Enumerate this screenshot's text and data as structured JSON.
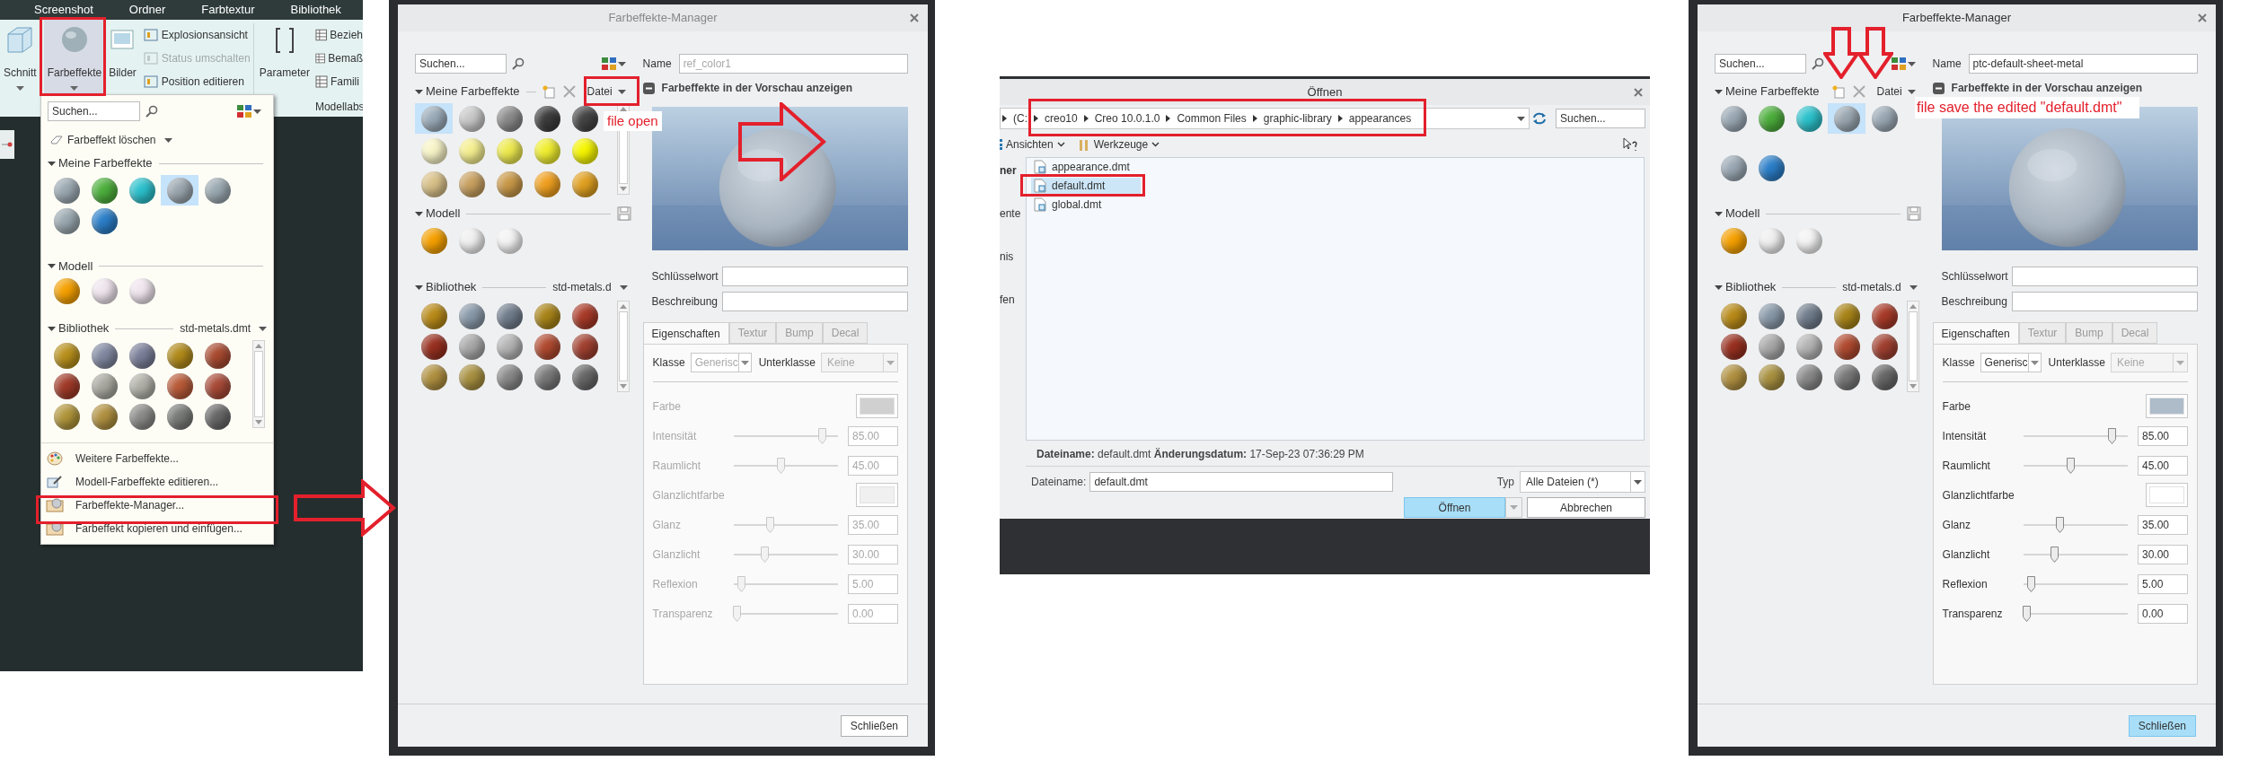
{
  "app_ribbon": {
    "menu_tabs": [
      {
        "label": "Screenshot",
        "selected": false
      },
      {
        "label": "Ordner",
        "selected": false
      },
      {
        "label": "Farbtextur",
        "selected": false
      },
      {
        "label": "Bibliothek",
        "selected": false
      }
    ],
    "large_buttons": [
      {
        "label": "Schnitt",
        "pressed": false
      },
      {
        "label": "Farbeffekte",
        "pressed": true
      },
      {
        "label": "Bilder",
        "pressed": false
      }
    ],
    "small_buttons": [
      {
        "label": "Explosionsansicht",
        "disabled": false
      },
      {
        "label": "Status umschalten",
        "disabled": true
      },
      {
        "label": "Position editieren",
        "disabled": false
      }
    ],
    "parameter_button": "Parameter",
    "small_buttons_2": [
      {
        "label": "Bezieh"
      },
      {
        "label": "Bemaß"
      },
      {
        "label": "Famili"
      }
    ],
    "group_label": "Modellabs"
  },
  "appearance_menu": {
    "search": {
      "placeholder": "Suchen..."
    },
    "delete_button": "Farbeffekt löschen",
    "my_section": {
      "title": "Meine Farbeffekte",
      "swatches": [
        {
          "color": "#9aa8b0",
          "selected": false
        },
        {
          "color": "#4caf3c",
          "selected": false
        },
        {
          "color": "#2bc0cc",
          "selected": false
        },
        {
          "color": "#9aa6ae",
          "selected": true
        },
        {
          "color": "#9aa8b0",
          "selected": false
        },
        {
          "color": "#9aa8b0",
          "selected": false
        },
        {
          "color": "#2b7ec8",
          "selected": false
        }
      ]
    },
    "model_section": {
      "title": "Modell",
      "swatches": [
        {
          "color": "#f5a000",
          "selected": false
        },
        {
          "color": "#f0e6ee",
          "selected": false
        },
        {
          "color": "#f0e6ee",
          "selected": false
        }
      ]
    },
    "library_section": {
      "title": "Bibliothek",
      "library": "std-metals.dmt",
      "swatches": [
        {
          "color": "#b8901c",
          "selected": false
        },
        {
          "color": "#8088a0",
          "selected": false
        },
        {
          "color": "#7a7e98",
          "selected": false
        },
        {
          "color": "#b08a1a",
          "selected": false
        },
        {
          "color": "#a84a30",
          "selected": false
        },
        {
          "color": "#a03a28",
          "selected": false
        },
        {
          "color": "#a8a8a0",
          "selected": false
        },
        {
          "color": "#b0b0a8",
          "selected": false
        },
        {
          "color": "#b85a38",
          "selected": false
        },
        {
          "color": "#a84a38",
          "selected": false
        },
        {
          "color": "#b0953a",
          "selected": false
        },
        {
          "color": "#b09040",
          "selected": false
        },
        {
          "color": "#8a8a88",
          "selected": false
        },
        {
          "color": "#787a78",
          "selected": false
        },
        {
          "color": "#686868",
          "selected": false
        }
      ]
    },
    "items": [
      "Weitere Farbeffekte...",
      "Modell-Farbeffekte editieren...",
      "Farbeffekte-Manager...",
      "Farbeffekt kopieren und einfügen..."
    ]
  },
  "manager_dialog_before": {
    "title": "Farbeffekte-Manager",
    "active": false,
    "search": {
      "placeholder": "Suchen..."
    },
    "file_menu": "Datei",
    "my_section": {
      "title": "Meine Farbeffekte",
      "swatches": [
        {
          "color": "#9aaab8",
          "selected": true
        },
        {
          "color": "#c8c8c8",
          "selected": false
        },
        {
          "color": "#8a8a8a",
          "selected": false
        },
        {
          "color": "#3c3c3c",
          "selected": false
        },
        {
          "color": "#444444",
          "selected": false
        },
        {
          "color": "#f8f4c8",
          "selected": false
        },
        {
          "color": "#f5ef90",
          "selected": false
        },
        {
          "color": "#eeea50",
          "selected": false
        },
        {
          "color": "#f0ee30",
          "selected": false
        },
        {
          "color": "#f5f500",
          "selected": false
        },
        {
          "color": "#d8c088",
          "selected": false
        },
        {
          "color": "#c8a060",
          "selected": false
        },
        {
          "color": "#c89848",
          "selected": false
        },
        {
          "color": "#f0a020",
          "selected": false
        },
        {
          "color": "#e0a020",
          "selected": false
        }
      ]
    },
    "model_section": {
      "title": "Modell",
      "swatches": [
        {
          "color": "#f5a000",
          "selected": false
        },
        {
          "color": "#f0f0f0",
          "selected": false
        },
        {
          "color": "#f4f4f4",
          "selected": false
        }
      ]
    },
    "library_section": {
      "title": "Bibliothek",
      "library": "std-metals.d",
      "swatches": [
        {
          "color": "#b88a18",
          "selected": false
        },
        {
          "color": "#8898a8",
          "selected": false
        },
        {
          "color": "#707c8c",
          "selected": false
        },
        {
          "color": "#a88418",
          "selected": false
        },
        {
          "color": "#a83a28",
          "selected": false
        },
        {
          "color": "#983020",
          "selected": false
        },
        {
          "color": "#a8a8a8",
          "selected": false
        },
        {
          "color": "#b4b4b4",
          "selected": false
        },
        {
          "color": "#b04a30",
          "selected": false
        },
        {
          "color": "#a04030",
          "selected": false
        },
        {
          "color": "#b09040",
          "selected": false
        },
        {
          "color": "#a89040",
          "selected": false
        },
        {
          "color": "#888888",
          "selected": false
        },
        {
          "color": "#787878",
          "selected": false
        },
        {
          "color": "#686868",
          "selected": false
        }
      ]
    },
    "name": {
      "label": "Name",
      "value": "ref_color1",
      "disabled": true
    },
    "preview_toggle": "Farbeffekte in der Vorschau anzeigen",
    "fields": [
      {
        "label": "Schlüsselwort"
      },
      {
        "label": "Beschreibung"
      }
    ],
    "tabs": [
      {
        "label": "Eigenschaften",
        "selected": true,
        "disabled": false
      },
      {
        "label": "Textur",
        "selected": false,
        "disabled": true
      },
      {
        "label": "Bump",
        "selected": false,
        "disabled": true
      },
      {
        "label": "Decal",
        "selected": false,
        "disabled": true
      }
    ],
    "properties": {
      "disabled": true,
      "class_select": {
        "label": "Klasse",
        "value": "Generisc",
        "disabled": true
      },
      "subclass_select": {
        "label": "Unterklasse",
        "value": "Keine",
        "disabled": true
      },
      "rows": [
        {
          "kind": "color",
          "label": "Farbe",
          "color": "#d0d0d0"
        },
        {
          "kind": "slider",
          "label": "Intensität",
          "level": 0.85,
          "value": "85.00"
        },
        {
          "kind": "slider",
          "label": "Raumlicht",
          "level": 0.45,
          "value": "45.00"
        },
        {
          "kind": "color",
          "label": "Glanzlichtfarbe",
          "color": "#f0f0f0"
        },
        {
          "kind": "slider",
          "label": "Glanz",
          "level": 0.35,
          "value": "35.00"
        },
        {
          "kind": "slider",
          "label": "Glanzlicht",
          "level": 0.3,
          "value": "30.00"
        },
        {
          "kind": "slider",
          "label": "Reflexion",
          "level": 0.07,
          "value": "5.00"
        },
        {
          "kind": "slider",
          "label": "Transparenz",
          "level": 0.03,
          "value": "0.00"
        }
      ]
    },
    "close_button": {
      "label": "Schließen",
      "default": false
    },
    "annotation": "file open"
  },
  "open_dialog": {
    "title": "Öffnen",
    "path": [
      "(C:",
      "creo10",
      "Creo 10.0.1.0",
      "Common Files",
      "graphic-library",
      "appearances"
    ],
    "search": {
      "placeholder": "Suchen..."
    },
    "toolbar": [
      "Ansichten",
      "Werkzeuge"
    ],
    "sidebar": [
      {
        "label": "ner",
        "kind": "header"
      },
      {
        "label": "ente",
        "kind": "item"
      },
      {
        "label": "nis",
        "kind": "item"
      },
      {
        "label": "fen",
        "kind": "item"
      }
    ],
    "files": [
      {
        "name": "appearance.dmt",
        "selected": false
      },
      {
        "name": "default.dmt",
        "selected": true
      },
      {
        "name": "global.dmt",
        "selected": false
      }
    ],
    "info": "**Dateiname:** default.dmt **Änderungsdatum:** 17-Sep-23 07:36:29 PM",
    "filename": {
      "label": "Dateiname:",
      "value": "default.dmt"
    },
    "type": {
      "label": "Typ",
      "value": "Alle Dateien (*)"
    },
    "buttons": [
      {
        "label": "Öffnen",
        "primary": true
      },
      {
        "label": "Abbrechen",
        "primary": false
      }
    ]
  },
  "manager_dialog_after": {
    "title": "Farbeffekte-Manager",
    "active": true,
    "search": {
      "placeholder": "Suchen..."
    },
    "file_menu": "Datei",
    "my_section": {
      "title": "Meine Farbeffekte",
      "swatches": [
        {
          "color": "#9aa8b4",
          "selected": false
        },
        {
          "color": "#4cae3c",
          "selected": false
        },
        {
          "color": "#2cc2cc",
          "selected": false
        },
        {
          "color": "#9aa6b0",
          "selected": true
        },
        {
          "color": "#9aa8b4",
          "selected": false
        },
        {
          "color": "#9aa8b4",
          "selected": false
        },
        {
          "color": "#2b7ec8",
          "selected": false
        }
      ]
    },
    "model_section": {
      "title": "Modell",
      "swatches": [
        {
          "color": "#f5a000",
          "selected": false
        },
        {
          "color": "#f0f0f0",
          "selected": false
        },
        {
          "color": "#f4f4f4",
          "selected": false
        }
      ]
    },
    "library_section": {
      "title": "Bibliothek",
      "library": "std-metals.d",
      "swatches": [
        {
          "color": "#b88a18",
          "selected": false
        },
        {
          "color": "#8898a8",
          "selected": false
        },
        {
          "color": "#707c8c",
          "selected": false
        },
        {
          "color": "#a88418",
          "selected": false
        },
        {
          "color": "#a83a28",
          "selected": false
        },
        {
          "color": "#983020",
          "selected": false
        },
        {
          "color": "#a8a8a8",
          "selected": false
        },
        {
          "color": "#b4b4b4",
          "selected": false
        },
        {
          "color": "#b04a30",
          "selected": false
        },
        {
          "color": "#a04030",
          "selected": false
        },
        {
          "color": "#b09040",
          "selected": false
        },
        {
          "color": "#a89040",
          "selected": false
        },
        {
          "color": "#888888",
          "selected": false
        },
        {
          "color": "#787878",
          "selected": false
        },
        {
          "color": "#686868",
          "selected": false
        }
      ]
    },
    "name": {
      "label": "Name",
      "value": "ptc-default-sheet-metal",
      "disabled": false
    },
    "preview_toggle": "Farbeffekte in der Vorschau anzeigen",
    "fields": [
      {
        "label": "Schlüsselwort"
      },
      {
        "label": "Beschreibung"
      }
    ],
    "tabs": [
      {
        "label": "Eigenschaften",
        "selected": true,
        "disabled": false
      },
      {
        "label": "Textur",
        "selected": false,
        "disabled": true
      },
      {
        "label": "Bump",
        "selected": false,
        "disabled": true
      },
      {
        "label": "Decal",
        "selected": false,
        "disabled": true
      }
    ],
    "properties": {
      "disabled": false,
      "class_select": {
        "label": "Klasse",
        "value": "Generisc",
        "disabled": false
      },
      "subclass_select": {
        "label": "Unterklasse",
        "value": "Keine",
        "disabled": true
      },
      "rows": [
        {
          "kind": "color",
          "label": "Farbe",
          "color": "#aebcca"
        },
        {
          "kind": "slider",
          "label": "Intensität",
          "level": 0.85,
          "value": "85.00"
        },
        {
          "kind": "slider",
          "label": "Raumlicht",
          "level": 0.45,
          "value": "45.00"
        },
        {
          "kind": "color",
          "label": "Glanzlichtfarbe",
          "color": "#ffffff"
        },
        {
          "kind": "slider",
          "label": "Glanz",
          "level": 0.35,
          "value": "35.00"
        },
        {
          "kind": "slider",
          "label": "Glanzlicht",
          "level": 0.3,
          "value": "30.00"
        },
        {
          "kind": "slider",
          "label": "Reflexion",
          "level": 0.07,
          "value": "5.00"
        },
        {
          "kind": "slider",
          "label": "Transparenz",
          "level": 0.03,
          "value": "0.00"
        }
      ]
    },
    "close_button": {
      "label": "Schließen",
      "default": true
    },
    "annotation": "file save the edited \"default.dmt\""
  }
}
